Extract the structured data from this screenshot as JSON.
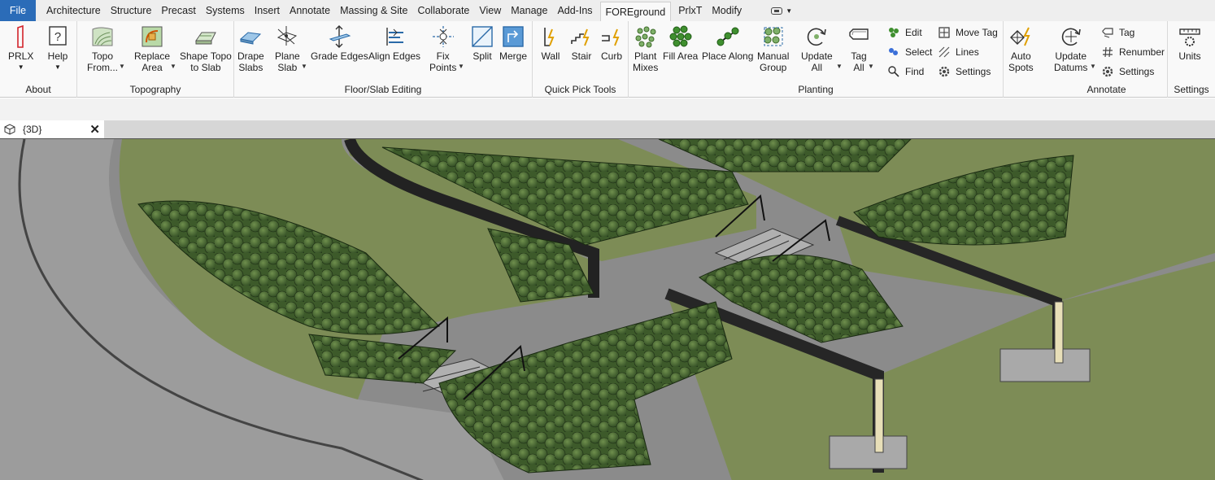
{
  "menu": {
    "tabs": [
      "File",
      "Architecture",
      "Structure",
      "Precast",
      "Systems",
      "Insert",
      "Annotate",
      "Massing & Site",
      "Collaborate",
      "View",
      "Manage",
      "Add-Ins",
      "FOREground",
      "PrlxT",
      "Modify"
    ],
    "active": "FOREground"
  },
  "ribbon": {
    "panels": {
      "about": "About",
      "topography": "Topography",
      "floor_slab": "Floor/Slab Editing",
      "quick_pick": "Quick Pick Tools",
      "planting": "Planting",
      "annotate": "Annotate",
      "settings": "Settings"
    },
    "buttons": {
      "prlx": "PRLX",
      "help": "Help",
      "topo_from": [
        "Topo",
        "From..."
      ],
      "replace_area": [
        "Replace",
        "Area"
      ],
      "shape_topo": [
        "Shape Topo",
        "to Slab"
      ],
      "drape_slabs": [
        "Drape",
        "Slabs"
      ],
      "plane_slab": [
        "Plane",
        "Slab"
      ],
      "grade_edges": "Grade Edges",
      "align_edges": "Align Edges",
      "fix_points": [
        "Fix",
        "Points"
      ],
      "split": "Split",
      "merge": "Merge",
      "wall": "Wall",
      "stair": "Stair",
      "curb": "Curb",
      "plant_mixes": [
        "Plant",
        "Mixes"
      ],
      "fill_area": "Fill Area",
      "place_along": "Place Along",
      "manual_group": [
        "Manual",
        "Group"
      ],
      "update_all": [
        "Update",
        "All"
      ],
      "tag_all": [
        "Tag",
        "All"
      ],
      "auto_spots": [
        "Auto",
        "Spots"
      ],
      "update_datums": [
        "Update",
        "Datums"
      ],
      "units": "Units"
    },
    "small_buttons": {
      "edit": "Edit",
      "select": "Select",
      "find": "Find",
      "move_tag": "Move Tag",
      "lines": "Lines",
      "settings": "Settings",
      "tag": "Tag",
      "renumber": "Renumber",
      "annotate_settings": "Settings"
    }
  },
  "view": {
    "tab_label": "{3D}",
    "close_glyph": "✕"
  },
  "colors": {
    "file_tab": "#2b6cb8",
    "grass": "#7d8c56",
    "path": "#9a9a9a",
    "wall": "#3a3a3a",
    "tree": "#4f6e34"
  },
  "icons": [
    "prlx-icon",
    "help-icon",
    "topo-icon",
    "replace-area-icon",
    "shape-topo-icon",
    "drape-slabs-icon",
    "plane-slab-icon",
    "grade-edges-icon",
    "align-edges-icon",
    "fix-points-icon",
    "split-icon",
    "merge-icon",
    "wall-icon",
    "stair-icon",
    "curb-icon",
    "plant-mixes-icon",
    "fill-area-icon",
    "place-along-icon",
    "manual-group-icon",
    "update-all-icon",
    "tag-all-icon",
    "auto-spots-icon",
    "update-datums-icon",
    "units-icon",
    "cube-3d-icon"
  ]
}
